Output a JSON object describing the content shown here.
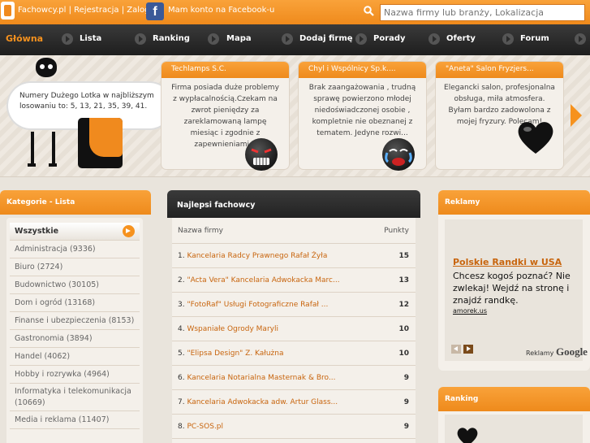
{
  "topbar": {
    "site": "Fachowcy.pl",
    "sep": "|",
    "register": "Rejestracja",
    "login": "Zaloguj",
    "facebook_glyph": "f",
    "facebook_text": "Mam konto na Facebook-u",
    "search_placeholder": "Nazwa firmy lub branży, Lokalizacja"
  },
  "nav": {
    "items": [
      {
        "label": "Główna"
      },
      {
        "label": "Lista"
      },
      {
        "label": "Ranking"
      },
      {
        "label": "Mapa"
      },
      {
        "label": "Dodaj firmę"
      },
      {
        "label": "Porady"
      },
      {
        "label": "Oferty"
      },
      {
        "label": "Forum"
      }
    ]
  },
  "hero": {
    "lotto_text": "Numery Dużego Lotka w najbliższym losowaniu to: 5, 13, 21, 35, 39, 41.",
    "opinions": [
      {
        "title": "Techlamps S.C.",
        "text": "Firma posiada duże problemy z wypłacalnością.Czekam na zwrot pieniędzy za zareklamowaną lampę miesiąc i zgodnie z zapewnieniami..."
      },
      {
        "title": "Chyl i Wspólnicy Sp.k....",
        "text": "Brak zaangażowania , trudną sprawę powierzono młodej niedoświadczonej osobie , kompletnie nie obeznanej z tematem. Jedyne rozwi..."
      },
      {
        "title": "\"Aneta\" Salon Fryzjers...",
        "text": "Elegancki salon, profesjonalna obsługa, miła atmosfera. Byłam bardzo zadowolona z mojej fryzury. Polecam!"
      }
    ]
  },
  "categories": {
    "title": "Kategorie - Lista",
    "items": [
      {
        "label": "Wszystkie"
      },
      {
        "label": "Administracja (9336)"
      },
      {
        "label": "Biuro (2724)"
      },
      {
        "label": "Budownictwo (30105)"
      },
      {
        "label": "Dom i ogród (13168)"
      },
      {
        "label": "Finanse i ubezpieczenia (8153)"
      },
      {
        "label": "Gastronomia (3894)"
      },
      {
        "label": "Handel (4062)"
      },
      {
        "label": "Hobby i rozrywka (4964)"
      },
      {
        "label": "Informatyka i telekomunikacja (10669)"
      },
      {
        "label": "Media i reklama (11407)"
      }
    ]
  },
  "best": {
    "title": "Najlepsi fachowcy",
    "col_name": "Nazwa firmy",
    "col_points": "Punkty",
    "rows": [
      {
        "num": "1.",
        "name": "Kancelaria Radcy Prawnego Rafał Żyła",
        "points": "15"
      },
      {
        "num": "2.",
        "name": "\"Acta Vera\" Kancelaria Adwokacka Marc...",
        "points": "13"
      },
      {
        "num": "3.",
        "name": "\"FotoRaf\" Usługi Fotograficzne Rafał ...",
        "points": "12"
      },
      {
        "num": "4.",
        "name": "Wspaniałe Ogrody Maryli",
        "points": "10"
      },
      {
        "num": "5.",
        "name": "\"Elipsa Design\" Z. Kałużna",
        "points": "10"
      },
      {
        "num": "6.",
        "name": "Kancelaria Notarialna Masternak & Bro...",
        "points": "9"
      },
      {
        "num": "7.",
        "name": "Kancelaria Adwokacka adw. Artur Glass...",
        "points": "9"
      },
      {
        "num": "8.",
        "name": "PC-SOS.pl",
        "points": "9"
      }
    ]
  },
  "ads": {
    "title": "Reklamy",
    "ad_title": "Polskie Randki w USA",
    "ad_text": "Chcesz kogoś poznać? Nie zwlekaj! Wejdź na stronę i znajdź randkę.",
    "ad_url": "amorek.us",
    "google_label": "Reklamy",
    "google_brand": "Google"
  },
  "ranking": {
    "title": "Ranking"
  },
  "colors": {
    "accent": "#f6921e",
    "dark": "#2a2a2a",
    "link": "#c8650e"
  }
}
